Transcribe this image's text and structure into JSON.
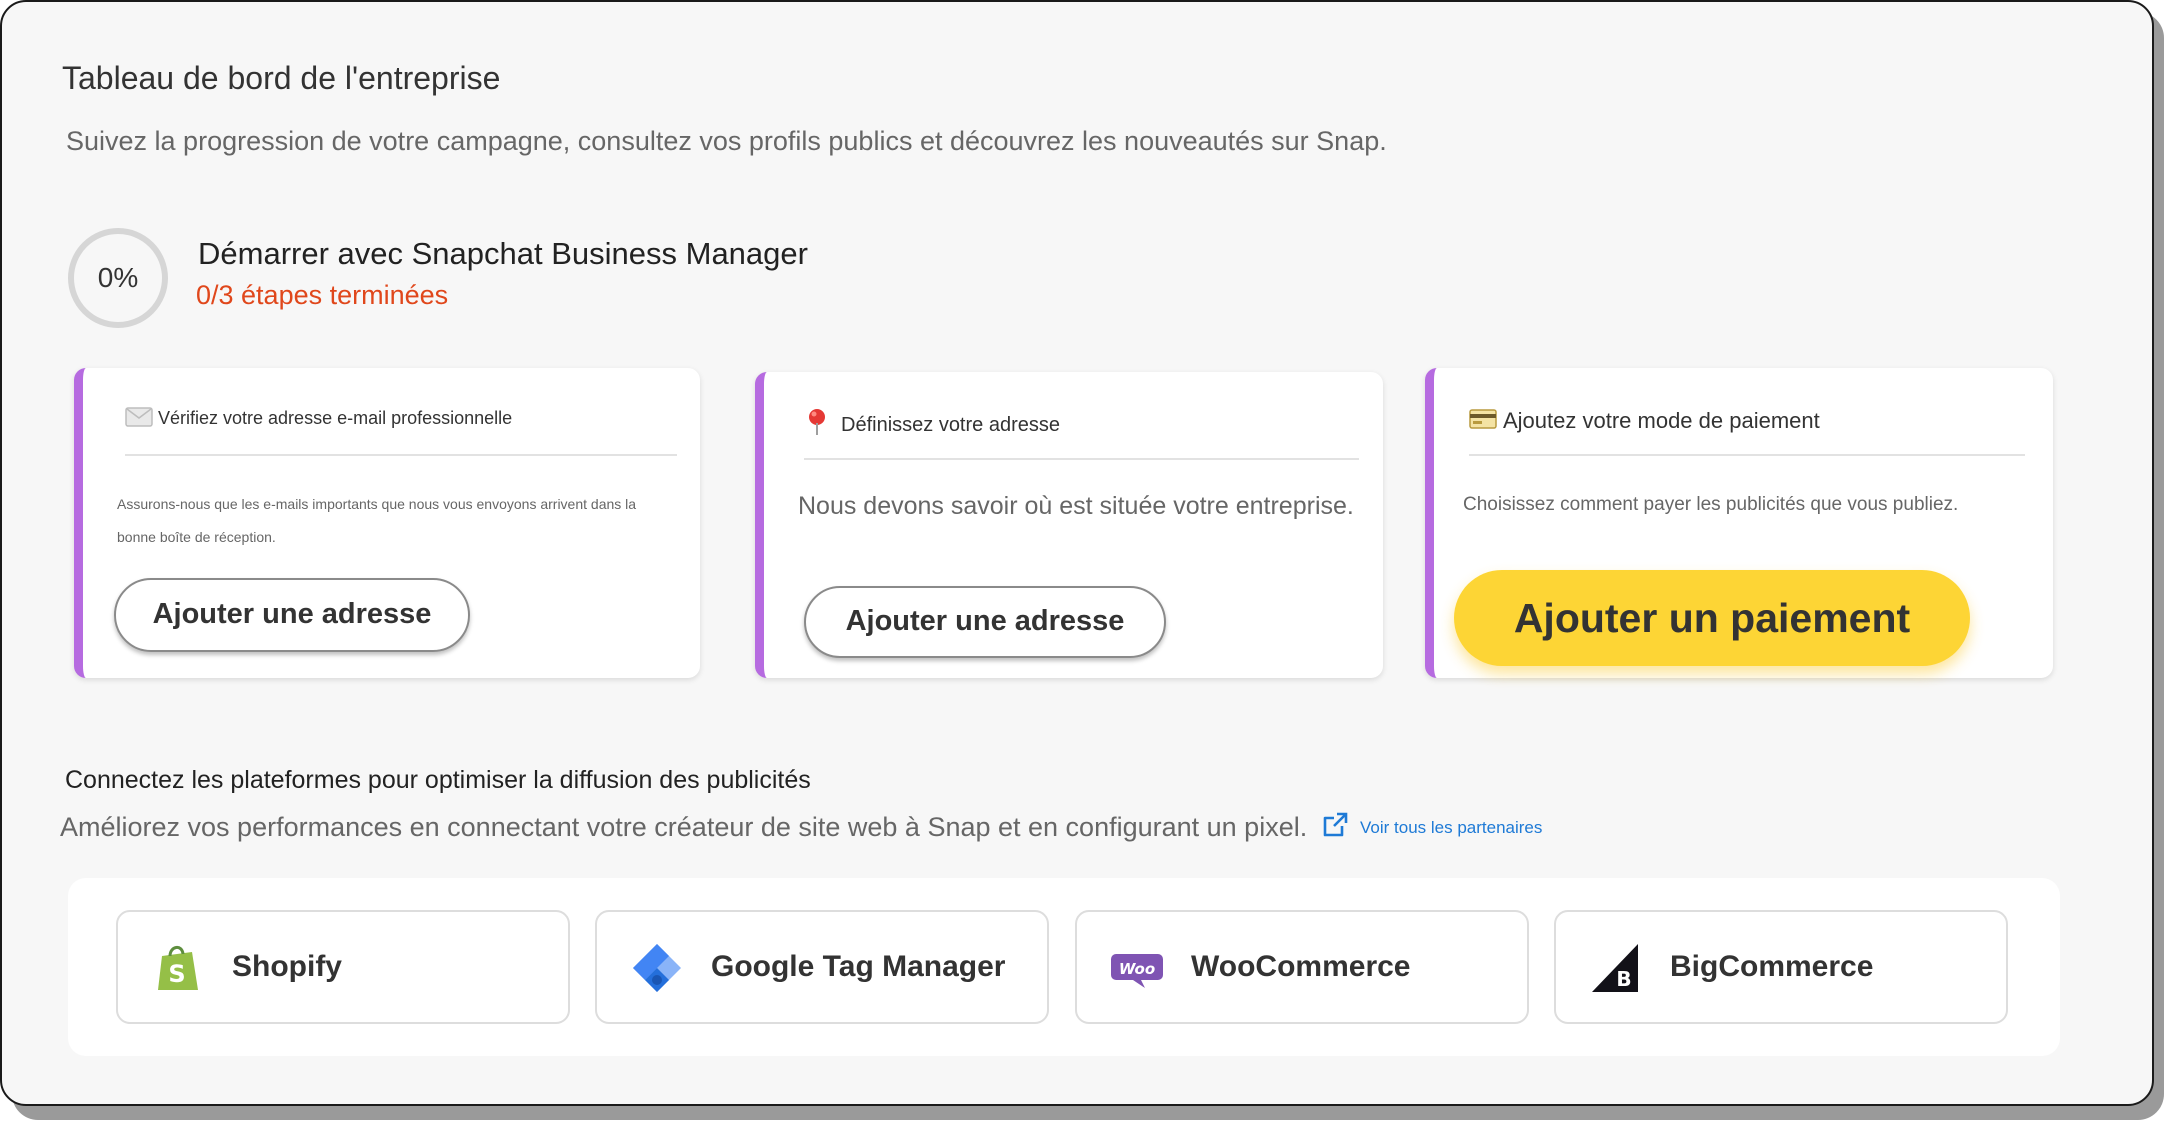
{
  "page": {
    "title": "Tableau de bord de l'entreprise",
    "subtitle": "Suivez la progression de votre campagne, consultez vos profils publics et découvrez les nouveautés sur Snap."
  },
  "onboarding": {
    "progress_label": "0%",
    "progress_value": 0,
    "title": "Démarrer avec Snapchat Business Manager",
    "steps_status": "0/3 étapes terminées",
    "steps_color": "#e0471b"
  },
  "cards": [
    {
      "icon": "envelope-icon",
      "heading": "Vérifiez votre adresse e-mail professionnelle",
      "body": "Assurons-nous que les e-mails importants que nous vous envoyons arrivent dans la bonne boîte de réception.",
      "button": "Ajouter une adresse"
    },
    {
      "icon": "pin-icon",
      "heading": "Définissez votre adresse",
      "body": "Nous devons savoir où est située votre entreprise.",
      "button": "Ajouter une adresse"
    },
    {
      "icon": "credit-card-icon",
      "heading": "Ajoutez votre mode de paiement",
      "body": "Choisissez comment payer les publicités que vous publiez.",
      "button": "Ajouter  un paiement"
    }
  ],
  "platforms_section": {
    "title": "Connectez les plateformes pour optimiser la diffusion des publicités",
    "subtitle": "Améliorez vos performances en connectant votre créateur de site web à Snap et en configurant un pixel.",
    "link": "Voir tous les partenaires",
    "items": [
      {
        "name": "Shopify",
        "icon": "shopify-icon"
      },
      {
        "name": "Google Tag Manager",
        "icon": "google-tag-manager-icon"
      },
      {
        "name": "WooCommerce",
        "icon": "woocommerce-icon"
      },
      {
        "name": "BigCommerce",
        "icon": "bigcommerce-icon"
      }
    ]
  },
  "colors": {
    "accent_border": "#b66be0",
    "primary_button": "#fdd535",
    "link": "#1e7ad6"
  }
}
